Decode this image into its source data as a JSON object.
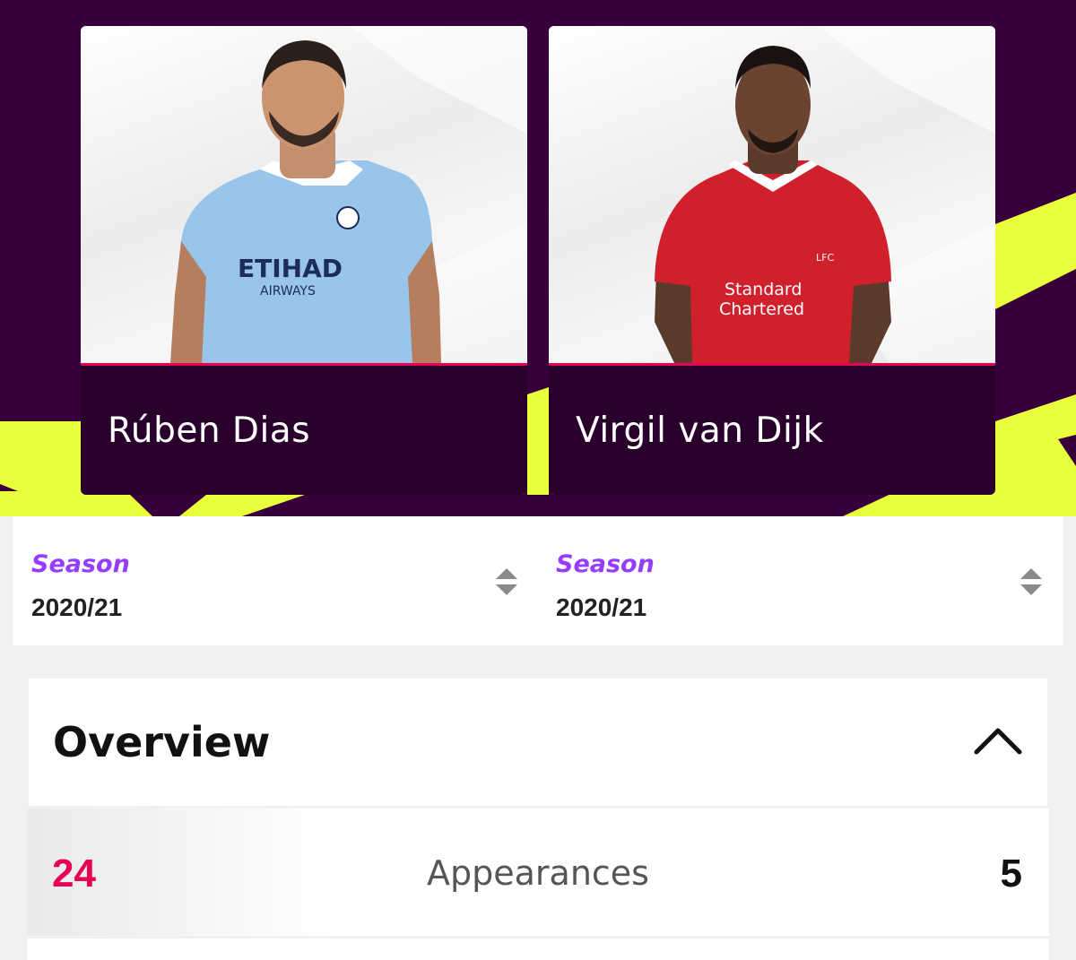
{
  "players": [
    {
      "name": "Rúben Dias",
      "kit": "Manchester City"
    },
    {
      "name": "Virgil van Dijk",
      "kit": "Liverpool"
    }
  ],
  "season_selectors": [
    {
      "label": "Season",
      "value": "2020/21"
    },
    {
      "label": "Season",
      "value": "2020/21"
    }
  ],
  "overview": {
    "title": "Overview",
    "rows": [
      {
        "left_value": "24",
        "label": "Appearances",
        "right_value": "5"
      }
    ]
  },
  "colors": {
    "hero_bg": "#37003c",
    "accent_yellow": "#eaff3c",
    "name_bar": "#28002b",
    "pink": "#e90052",
    "purple": "#963cff"
  },
  "icons": [
    "sort-arrows-icon",
    "chevron-up-icon"
  ]
}
